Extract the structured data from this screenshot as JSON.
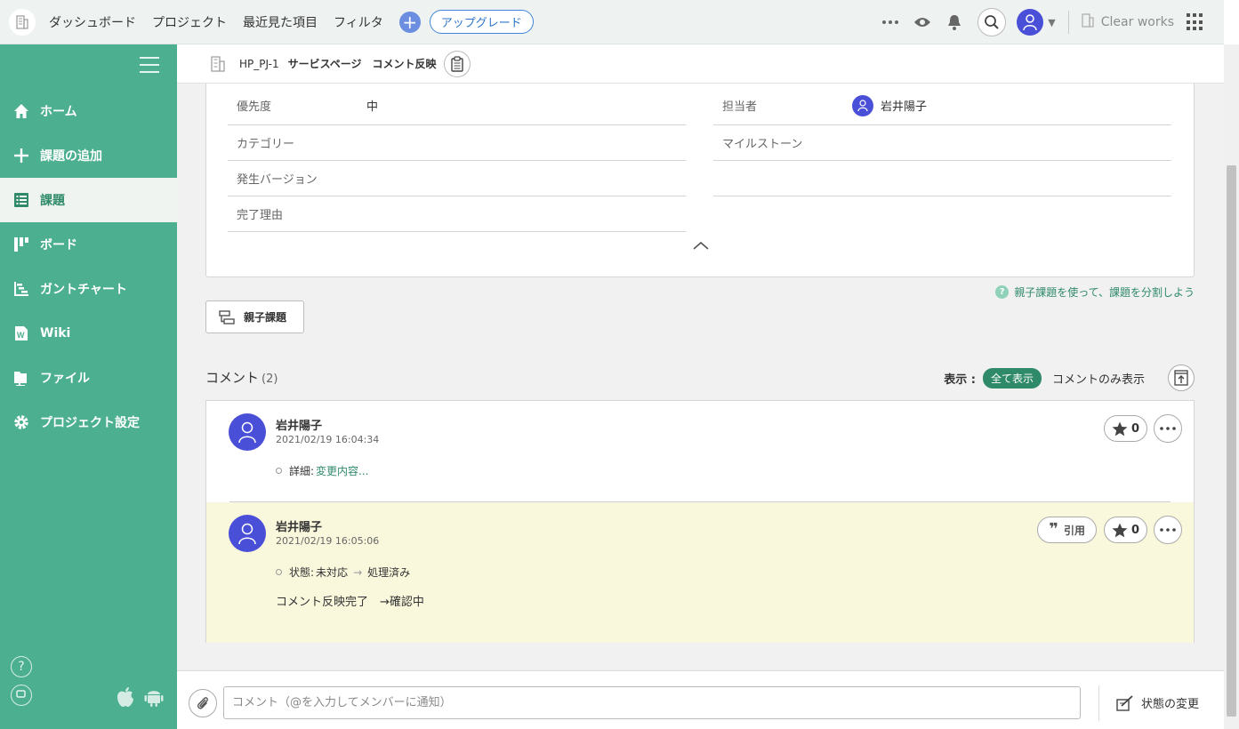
{
  "topbar": {
    "nav": [
      "ダッシュボード",
      "プロジェクト",
      "最近見た項目",
      "フィルタ"
    ],
    "upgrade_label": "アップグレード",
    "space_name": "Clear works"
  },
  "sidebar": {
    "items": [
      {
        "label": "ホーム",
        "icon": "home-icon"
      },
      {
        "label": "課題の追加",
        "icon": "plus-icon"
      },
      {
        "label": "課題",
        "icon": "list-icon",
        "active": true
      },
      {
        "label": "ボード",
        "icon": "board-icon"
      },
      {
        "label": "ガントチャート",
        "icon": "gantt-icon"
      },
      {
        "label": "Wiki",
        "icon": "wiki-icon"
      },
      {
        "label": "ファイル",
        "icon": "folder-icon"
      },
      {
        "label": "プロジェクト設定",
        "icon": "gear-icon"
      }
    ],
    "help_label": "?"
  },
  "breadcrumb": {
    "project_key": "HP_PJ-1",
    "category": "サービスページ",
    "title": "コメント反映"
  },
  "details": {
    "priority_label": "優先度",
    "priority_value": "中",
    "assignee_label": "担当者",
    "assignee_value": "岩井陽子",
    "category_label": "カテゴリー",
    "milestone_label": "マイルストーン",
    "version_label": "発生バージョン",
    "resolution_label": "完了理由"
  },
  "help_link": {
    "icon_text": "?",
    "text": "親子課題を使って、課題を分割しよう"
  },
  "parent_button": "親子課題",
  "comments": {
    "heading": "コメント",
    "count": "(2)",
    "display_label": "表示 :",
    "filter_all": "全て表示",
    "filter_comments_only": "コメントのみ表示",
    "items": [
      {
        "author": "岩井陽子",
        "time": "2021/02/19 16:04:34",
        "detail_label": "詳細:",
        "detail_link": "変更内容...",
        "stars": "0"
      },
      {
        "author": "岩井陽子",
        "time": "2021/02/19 16:05:06",
        "status_label": "状態:",
        "status_from": "未対応",
        "status_arrow": "→",
        "status_to": "処理済み",
        "body": "コメント反映完了　→確認中",
        "quote_icon": "❞",
        "quote_label": "引用",
        "stars": "0"
      }
    ]
  },
  "footer": {
    "input_placeholder": "コメント（@を入力してメンバーに通知）",
    "status_change_label": "状態の変更"
  },
  "colors": {
    "sidebar": "#4caf8f",
    "accent": "#2f8a6a",
    "avatar": "#4a4fd8",
    "highlight_comment": "#f9f7dc"
  }
}
